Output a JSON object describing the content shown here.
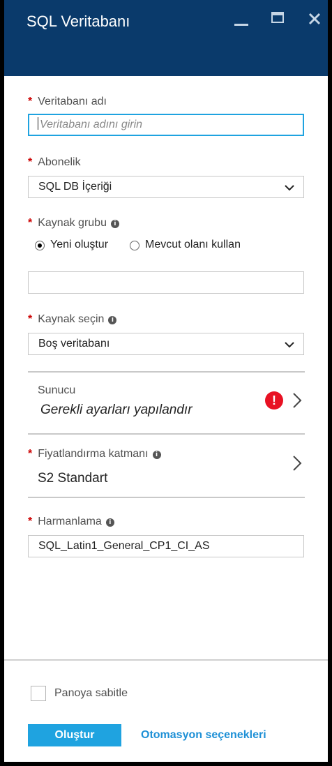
{
  "window": {
    "title": "SQL Veritabanı",
    "icons": [
      "minimize-icon",
      "maximize-icon",
      "close-icon"
    ],
    "colors": {
      "titlebar": "#0a3a6b",
      "accent": "#1fa3e0",
      "required": "#cc0000",
      "error": "#e81123",
      "link": "#1e90d6"
    }
  },
  "form": {
    "db_name": {
      "label": "Veritabanı adı",
      "required": "*",
      "placeholder": "Veritabanı adını girin"
    },
    "subscription": {
      "label": "Abonelik",
      "required": "*",
      "value": "SQL DB İçeriği"
    },
    "resource_group": {
      "label": "Kaynak grubu",
      "required": "*",
      "info": "i",
      "options": [
        "Yeni oluştur",
        "Mevcut olanı kullan"
      ],
      "selected": "Yeni oluştur",
      "value": ""
    },
    "source": {
      "label": "Kaynak seçin",
      "required": "*",
      "info": "i",
      "value": "Boş veritabanı"
    },
    "server": {
      "title": "Sunucu",
      "value": "Gerekli ayarları yapılandır",
      "status": "!"
    },
    "pricing": {
      "label": "Fiyatlandırma katmanı",
      "required": "*",
      "info": "i",
      "value": "S2 Standart"
    },
    "collation": {
      "label": "Harmanlama",
      "required": "*",
      "info": "i",
      "value": "SQL_Latin1_General_CP1_CI_AS"
    }
  },
  "footer": {
    "pin_label": "Panoya sabitle",
    "pin_checked": false,
    "create_label": "Oluştur",
    "automation_label": "Otomasyon seçenekleri"
  }
}
